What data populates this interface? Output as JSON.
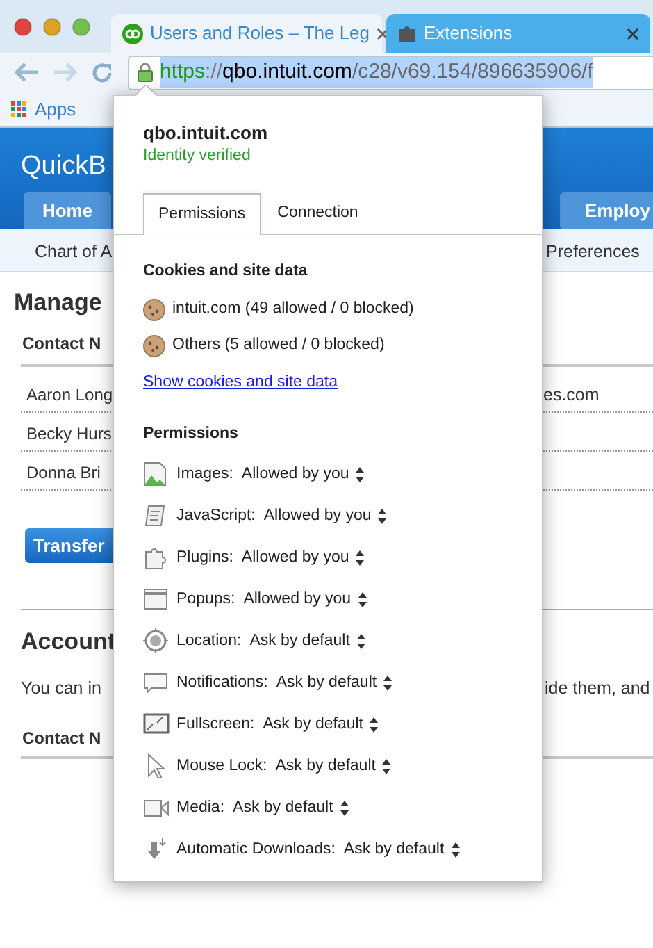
{
  "browser_tabs": [
    {
      "title": "Users and Roles – The Leg",
      "kind": "quickbooks",
      "selected": true
    },
    {
      "title": "Extensions",
      "kind": "extension",
      "selected": false
    }
  ],
  "address_bar": {
    "url_parts": [
      {
        "text": "https",
        "kind": "scheme"
      },
      {
        "text": "://",
        "kind": "punct"
      },
      {
        "text": "qbo.intuit.com",
        "kind": "host"
      },
      {
        "text": "/c28/v69.154/896635906/f",
        "kind": "path"
      }
    ]
  },
  "bookmarks": [
    {
      "label": "Apps"
    }
  ],
  "page": {
    "logo": "QuickB",
    "nav_left": "Home",
    "nav_right": "Employ",
    "subnav_left": "Chart of A",
    "subnav_right": "Preferences",
    "heading": "Manage",
    "users_table": {
      "columns": [
        "Contact N"
      ],
      "rows": [
        {
          "column_1": "Aaron Long",
          "column_2": "es.com"
        },
        {
          "column_1": "Becky Hurs"
        },
        {
          "column_1": "Donna Bri"
        }
      ]
    },
    "transfer_button": "Transfer",
    "section_heading": "Account",
    "paragraph_left": "You can in",
    "paragraph_right": "ide them, and",
    "accountants_table": {
      "columns": [
        "Contact N"
      ]
    }
  },
  "site_info_popup": {
    "site": "qbo.intuit.com",
    "identity": "Identity verified",
    "tabs": [
      {
        "label": "Permissions",
        "selected": true
      },
      {
        "label": "Connection",
        "selected": false
      }
    ],
    "cookies_heading": "Cookies and site data",
    "cookies": [
      {
        "label": "intuit.com (49 allowed / 0 blocked)"
      },
      {
        "label": "Others (5 allowed / 0 blocked)"
      }
    ],
    "cookies_link": "Show cookies and site data",
    "permissions_heading": "Permissions",
    "permissions": [
      {
        "kind": "images",
        "label": "Images:",
        "value": "Allowed by you"
      },
      {
        "kind": "javascript",
        "label": "JavaScript:",
        "value": "Allowed by you"
      },
      {
        "kind": "plugins",
        "label": "Plugins:",
        "value": "Allowed by you"
      },
      {
        "kind": "popups",
        "label": "Popups:",
        "value": "Allowed by you"
      },
      {
        "kind": "location",
        "label": "Location:",
        "value": "Ask by default"
      },
      {
        "kind": "notifications",
        "label": "Notifications:",
        "value": "Ask by default"
      },
      {
        "kind": "fullscreen",
        "label": "Fullscreen:",
        "value": "Ask by default"
      },
      {
        "kind": "mouse_lock",
        "label": "Mouse Lock:",
        "value": "Ask by default"
      },
      {
        "kind": "media",
        "label": "Media:",
        "value": "Ask by default"
      },
      {
        "kind": "downloads",
        "label": "Automatic Downloads:",
        "value": "Ask by default"
      }
    ]
  }
}
